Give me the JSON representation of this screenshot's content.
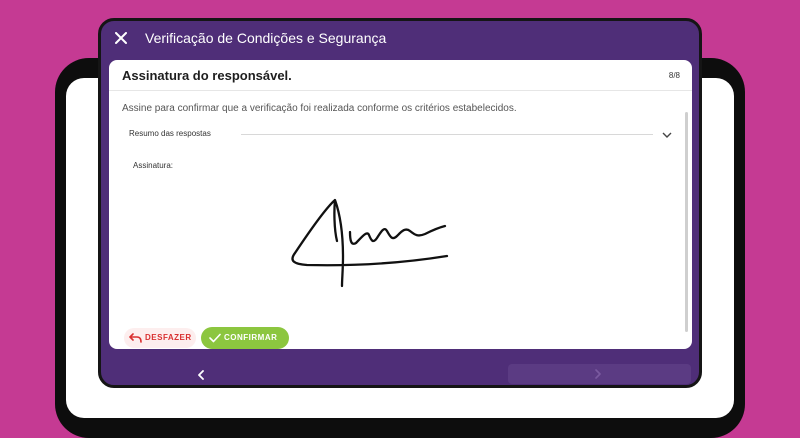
{
  "app": {
    "title": "Verificação de Condições e Segurança"
  },
  "card": {
    "title": "Assinatura do responsável.",
    "step": "8/8",
    "instruction": "Assine para confirmar que a verificação foi realizada conforme os critérios estabelecidos.",
    "summary_label": "Resumo das respostas",
    "signature_label": "Assinatura:"
  },
  "buttons": {
    "undo_label": "DESFAZER",
    "confirm_label": "CONFIRMAR"
  },
  "icons": {
    "close": "close-icon",
    "chevron": "chevron-down-icon",
    "undo": "undo-icon",
    "check": "check-icon",
    "prev": "chevron-left-icon",
    "next": "chevron-right-icon"
  },
  "colors": {
    "background": "#c53a93",
    "panel": "#4f2e78",
    "undo": "#d93030",
    "confirm": "#8cc63f"
  }
}
